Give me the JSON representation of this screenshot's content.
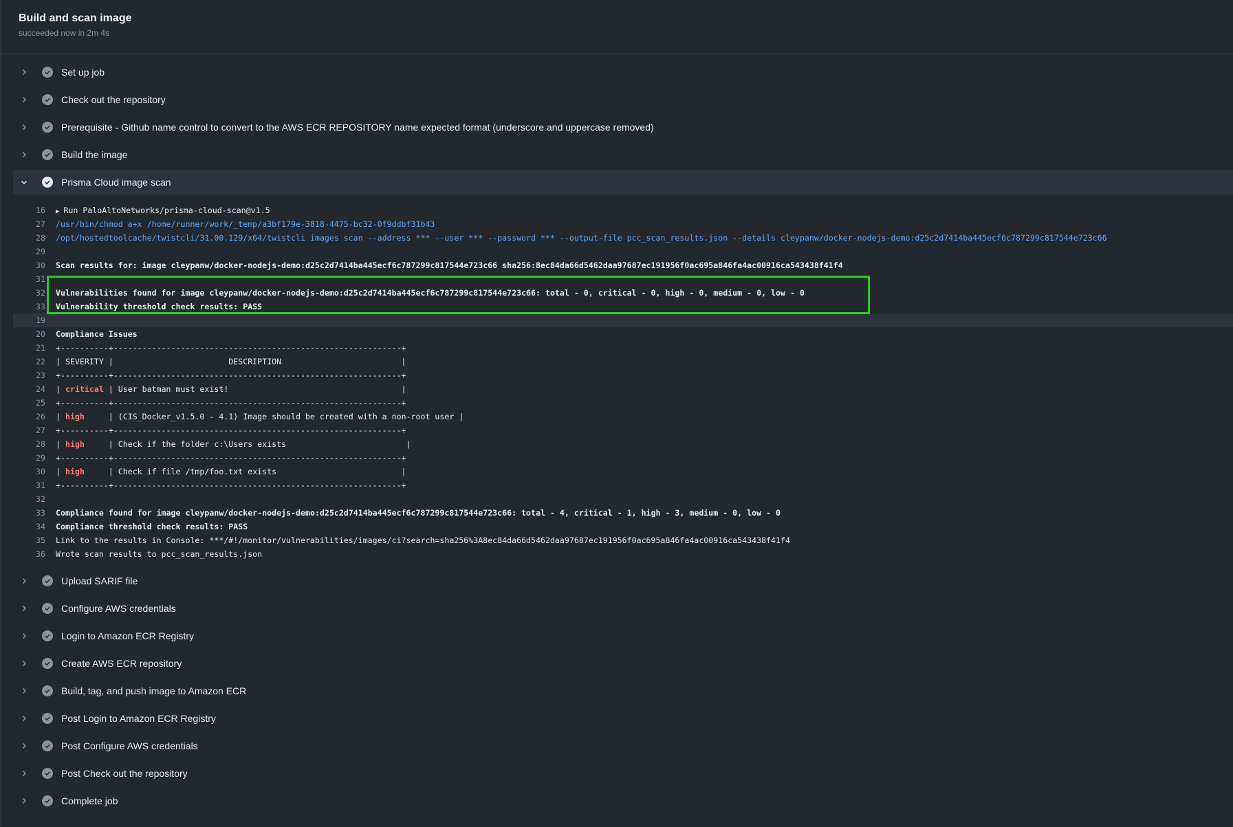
{
  "header": {
    "title": "Build and scan image",
    "subtitle": "succeeded now in 2m 4s"
  },
  "steps_before": [
    {
      "label": "Set up job"
    },
    {
      "label": "Check out the repository"
    },
    {
      "label": "Prerequisite - Github name control to convert to the AWS ECR REPOSITORY name expected format (underscore and uppercase removed)"
    },
    {
      "label": "Build the image"
    }
  ],
  "expanded_step": {
    "label": "Prisma Cloud image scan"
  },
  "log": {
    "run_line": {
      "num": "16",
      "text": "Run PaloAltoNetworks/prisma-cloud-scan@v1.5"
    },
    "lines": [
      {
        "num": "27",
        "text": "/usr/bin/chmod a+x /home/runner/work/_temp/a3bf179e-3818-4475-bc32-0f9ddbf31b43"
      },
      {
        "num": "28",
        "text": "/opt/hostedtoolcache/twistcli/31.00.129/x64/twistcli images scan --address *** --user *** --password *** --output-file pcc_scan_results.json --details cleypanw/docker-nodejs-demo:d25c2d7414ba445ecf6c787299c817544e723c66"
      },
      {
        "num": "29",
        "text": ""
      },
      {
        "num": "30",
        "text": "Scan results for: image cleypanw/docker-nodejs-demo:d25c2d7414ba445ecf6c787299c817544e723c66 sha256:8ec84da66d5462daa97687ec191956f0ac695a846fa4ac00916ca543438f41f4"
      },
      {
        "num": "31",
        "text": ""
      },
      {
        "num": "32",
        "text": "Vulnerabilities found for image cleypanw/docker-nodejs-demo:d25c2d7414ba445ecf6c787299c817544e723c66: total - 0, critical - 0, high - 0, medium - 0, low - 0"
      },
      {
        "num": "33",
        "text": "Vulnerability threshold check results: PASS"
      },
      {
        "num": "19",
        "text": ""
      },
      {
        "num": "20",
        "text": "Compliance Issues"
      },
      {
        "num": "21",
        "text": "+----------+------------------------------------------------------------+"
      },
      {
        "num": "22",
        "text": "| SEVERITY |                        DESCRIPTION                         |"
      },
      {
        "num": "23",
        "text": "+----------+------------------------------------------------------------+"
      },
      {
        "num": "24",
        "pre": "| ",
        "sev": "critical",
        "post": " | User batman must exist!                                    |"
      },
      {
        "num": "25",
        "text": "+----------+------------------------------------------------------------+"
      },
      {
        "num": "26",
        "pre": "| ",
        "sev": "high",
        "post": "     | (CIS_Docker_v1.5.0 - 4.1) Image should be created with a non-root user |"
      },
      {
        "num": "27",
        "text": "+----------+------------------------------------------------------------+"
      },
      {
        "num": "28",
        "pre": "| ",
        "sev": "high",
        "post": "     | Check if the folder c:\\Users exists                         |"
      },
      {
        "num": "29",
        "text": "+----------+------------------------------------------------------------+"
      },
      {
        "num": "30",
        "pre": "| ",
        "sev": "high",
        "post": "     | Check if file /tmp/foo.txt exists                          |"
      },
      {
        "num": "31",
        "text": "+----------+------------------------------------------------------------+"
      },
      {
        "num": "32",
        "text": ""
      },
      {
        "num": "33",
        "text": "Compliance found for image cleypanw/docker-nodejs-demo:d25c2d7414ba445ecf6c787299c817544e723c66: total - 4, critical - 1, high - 3, medium - 0, low - 0"
      },
      {
        "num": "34",
        "text": "Compliance threshold check results: PASS"
      },
      {
        "num": "35",
        "text": "Link to the results in Console: ***/#!/monitor/vulnerabilities/images/ci?search=sha256%3A8ec84da66d5462daa97687ec191956f0ac695a846fa4ac00916ca543438f41f4"
      },
      {
        "num": "36",
        "text": "Wrote scan results to pcc_scan_results.json"
      }
    ]
  },
  "steps_after": [
    {
      "label": "Upload SARIF file"
    },
    {
      "label": "Configure AWS credentials"
    },
    {
      "label": "Login to Amazon ECR Registry"
    },
    {
      "label": "Create AWS ECR repository"
    },
    {
      "label": "Build, tag, and push image to Amazon ECR"
    },
    {
      "label": "Post Login to Amazon ECR Registry"
    },
    {
      "label": "Post Configure AWS credentials"
    },
    {
      "label": "Post Check out the repository"
    },
    {
      "label": "Complete job"
    }
  ],
  "colors": {
    "highlight_box": "#1fd11f",
    "severity": "#ff7b72",
    "command": "#58a6ff"
  }
}
